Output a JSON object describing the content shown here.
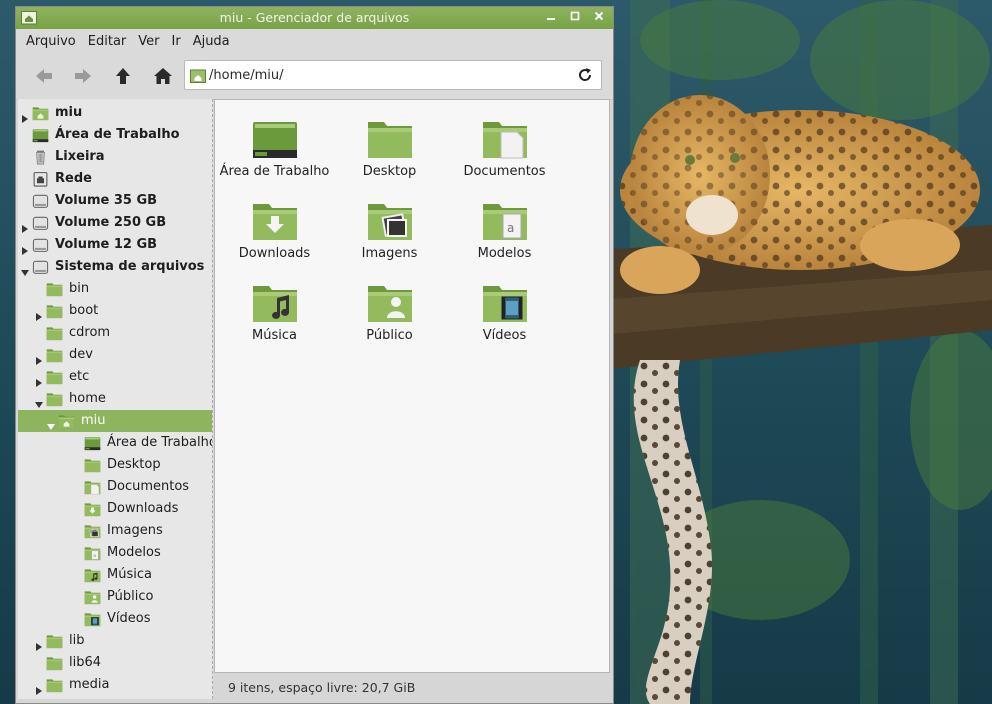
{
  "window": {
    "title": "miu - Gerenciador de arquivos"
  },
  "menubar": {
    "items": [
      "Arquivo",
      "Editar",
      "Ver",
      "Ir",
      "Ajuda"
    ]
  },
  "toolbar": {
    "back_icon": "arrow-left-icon",
    "forward_icon": "arrow-right-icon",
    "up_icon": "arrow-up-icon",
    "home_icon": "home-icon",
    "location_value": "/home/miu/",
    "reload_icon": "reload-icon"
  },
  "sidebar": {
    "items": [
      {
        "label": "miu",
        "expander": "collapsed",
        "icon": "home-folder-icon",
        "bold": true,
        "depth": 0
      },
      {
        "label": "Área de Trabalho",
        "expander": "none",
        "icon": "desktop-icon",
        "bold": true,
        "depth": 0
      },
      {
        "label": "Lixeira",
        "expander": "none",
        "icon": "trash-icon",
        "bold": true,
        "depth": 0
      },
      {
        "label": "Rede",
        "expander": "none",
        "icon": "network-icon",
        "bold": true,
        "depth": 0
      },
      {
        "label": "Volume 35 GB",
        "expander": "none",
        "icon": "drive-icon",
        "bold": true,
        "depth": 0
      },
      {
        "label": "Volume 250 GB",
        "expander": "collapsed",
        "icon": "drive-icon",
        "bold": true,
        "depth": 0
      },
      {
        "label": "Volume 12 GB",
        "expander": "collapsed",
        "icon": "drive-icon",
        "bold": true,
        "depth": 0
      },
      {
        "label": "Sistema de arquivos",
        "expander": "expanded",
        "icon": "drive-icon",
        "bold": true,
        "depth": 0
      },
      {
        "label": "bin",
        "expander": "none",
        "icon": "folder-icon",
        "bold": false,
        "depth": 1
      },
      {
        "label": "boot",
        "expander": "collapsed",
        "icon": "folder-icon",
        "bold": false,
        "depth": 1
      },
      {
        "label": "cdrom",
        "expander": "none",
        "icon": "folder-icon",
        "bold": false,
        "depth": 1
      },
      {
        "label": "dev",
        "expander": "collapsed",
        "icon": "folder-icon",
        "bold": false,
        "depth": 1
      },
      {
        "label": "etc",
        "expander": "collapsed",
        "icon": "folder-icon",
        "bold": false,
        "depth": 1
      },
      {
        "label": "home",
        "expander": "expanded",
        "icon": "folder-icon",
        "bold": false,
        "depth": 1
      },
      {
        "label": "miu",
        "expander": "expanded",
        "icon": "home-folder-icon",
        "bold": false,
        "depth": 2,
        "selected": true
      },
      {
        "label": "Área de Trabalho",
        "expander": "none",
        "icon": "desktop-icon",
        "bold": false,
        "depth": 3
      },
      {
        "label": "Desktop",
        "expander": "none",
        "icon": "folder-icon",
        "bold": false,
        "depth": 3
      },
      {
        "label": "Documentos",
        "expander": "none",
        "icon": "folder-documents-icon",
        "bold": false,
        "depth": 3
      },
      {
        "label": "Downloads",
        "expander": "none",
        "icon": "folder-download-icon",
        "bold": false,
        "depth": 3
      },
      {
        "label": "Imagens",
        "expander": "none",
        "icon": "folder-pictures-icon",
        "bold": false,
        "depth": 3
      },
      {
        "label": "Modelos",
        "expander": "none",
        "icon": "folder-templates-icon",
        "bold": false,
        "depth": 3
      },
      {
        "label": "Música",
        "expander": "none",
        "icon": "folder-music-icon",
        "bold": false,
        "depth": 3
      },
      {
        "label": "Público",
        "expander": "none",
        "icon": "folder-public-icon",
        "bold": false,
        "depth": 3
      },
      {
        "label": "Vídeos",
        "expander": "none",
        "icon": "folder-videos-icon",
        "bold": false,
        "depth": 3
      },
      {
        "label": "lib",
        "expander": "collapsed",
        "icon": "folder-icon",
        "bold": false,
        "depth": 1
      },
      {
        "label": "lib64",
        "expander": "none",
        "icon": "folder-icon",
        "bold": false,
        "depth": 1
      },
      {
        "label": "media",
        "expander": "collapsed",
        "icon": "folder-icon",
        "bold": false,
        "depth": 1
      }
    ]
  },
  "main": {
    "items": [
      {
        "name": "Área de Trabalho",
        "icon": "desktop-icon"
      },
      {
        "name": "Desktop",
        "icon": "folder-icon"
      },
      {
        "name": "Documentos",
        "icon": "folder-documents-icon"
      },
      {
        "name": "Downloads",
        "icon": "folder-download-icon"
      },
      {
        "name": "Imagens",
        "icon": "folder-pictures-icon"
      },
      {
        "name": "Modelos",
        "icon": "folder-templates-icon"
      },
      {
        "name": "Música",
        "icon": "folder-music-icon"
      },
      {
        "name": "Público",
        "icon": "folder-public-icon"
      },
      {
        "name": "Vídeos",
        "icon": "folder-videos-icon"
      }
    ]
  },
  "statusbar": {
    "text": "9 itens, espaço livre: 20,7 GiB"
  },
  "colors": {
    "accent": "#8db55d",
    "titlebar": "#7fa84b",
    "folder": "#8fb65a"
  }
}
